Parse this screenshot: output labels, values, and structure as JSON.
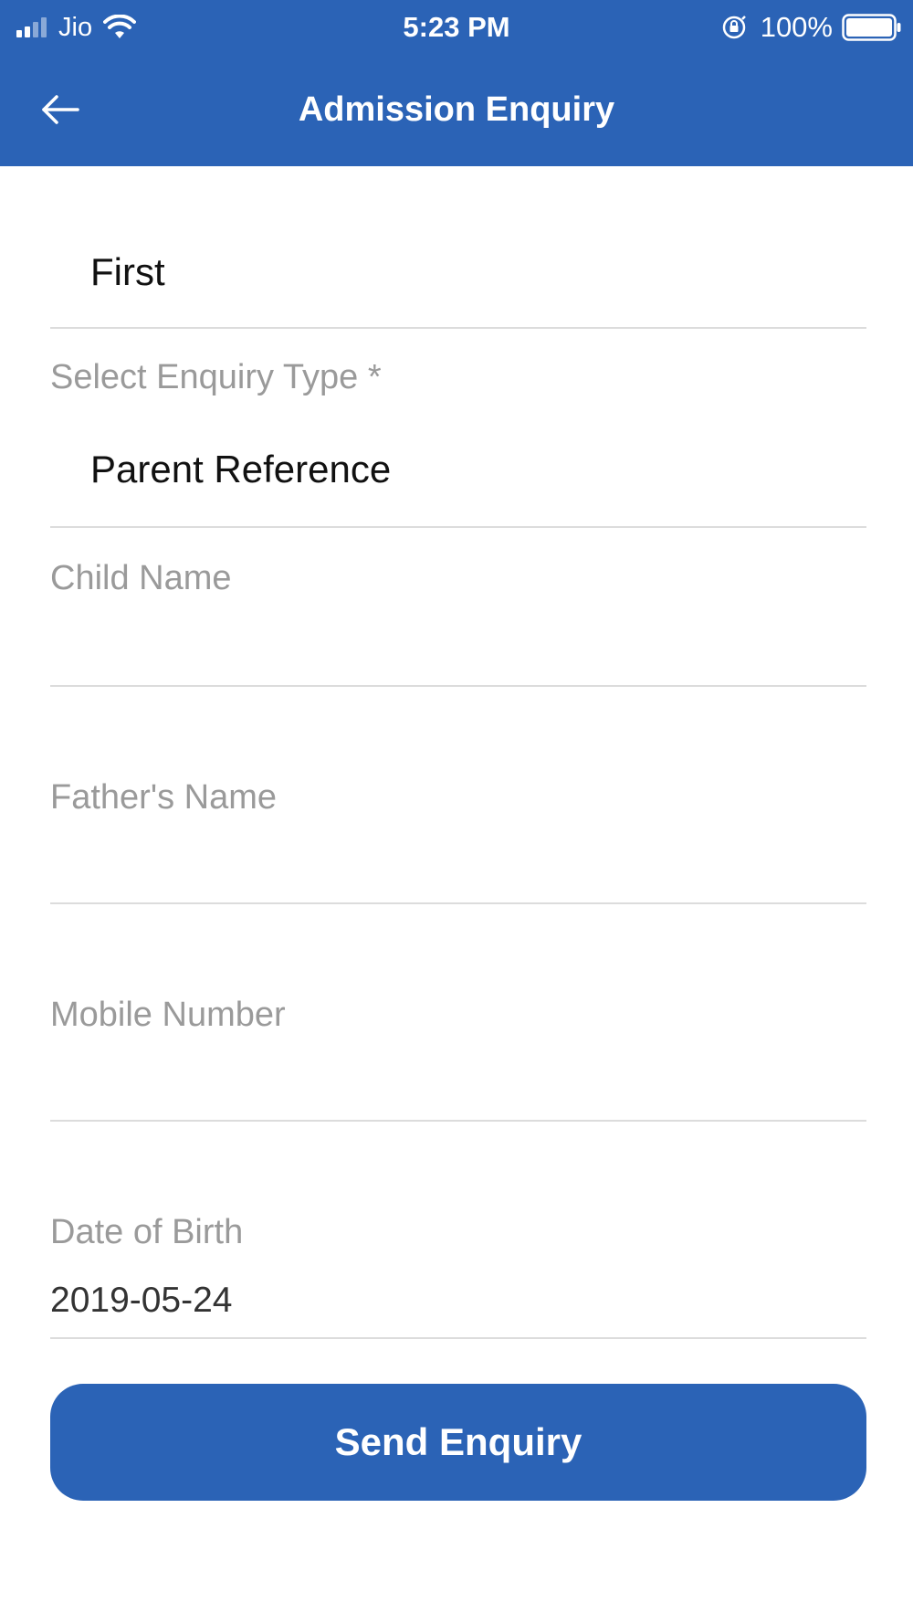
{
  "status_bar": {
    "carrier": "Jio",
    "time": "5:23 PM",
    "battery_percent": "100%",
    "signal_bars": 4,
    "signal_bars_active": 2
  },
  "header": {
    "title": "Admission Enquiry",
    "back_icon": "arrow-left-icon",
    "background_color": "#2b63b6"
  },
  "form": {
    "first_field": {
      "value": "First"
    },
    "enquiry_type": {
      "label": "Select Enquiry Type *",
      "value": "Parent Reference"
    },
    "child_name": {
      "placeholder": "Child Name",
      "value": ""
    },
    "father_name": {
      "placeholder": "Father's Name",
      "value": ""
    },
    "mobile_number": {
      "placeholder": "Mobile Number",
      "value": ""
    },
    "date_of_birth": {
      "label": "Date of Birth",
      "value": "2019-05-24"
    }
  },
  "actions": {
    "send_label": "Send Enquiry"
  }
}
